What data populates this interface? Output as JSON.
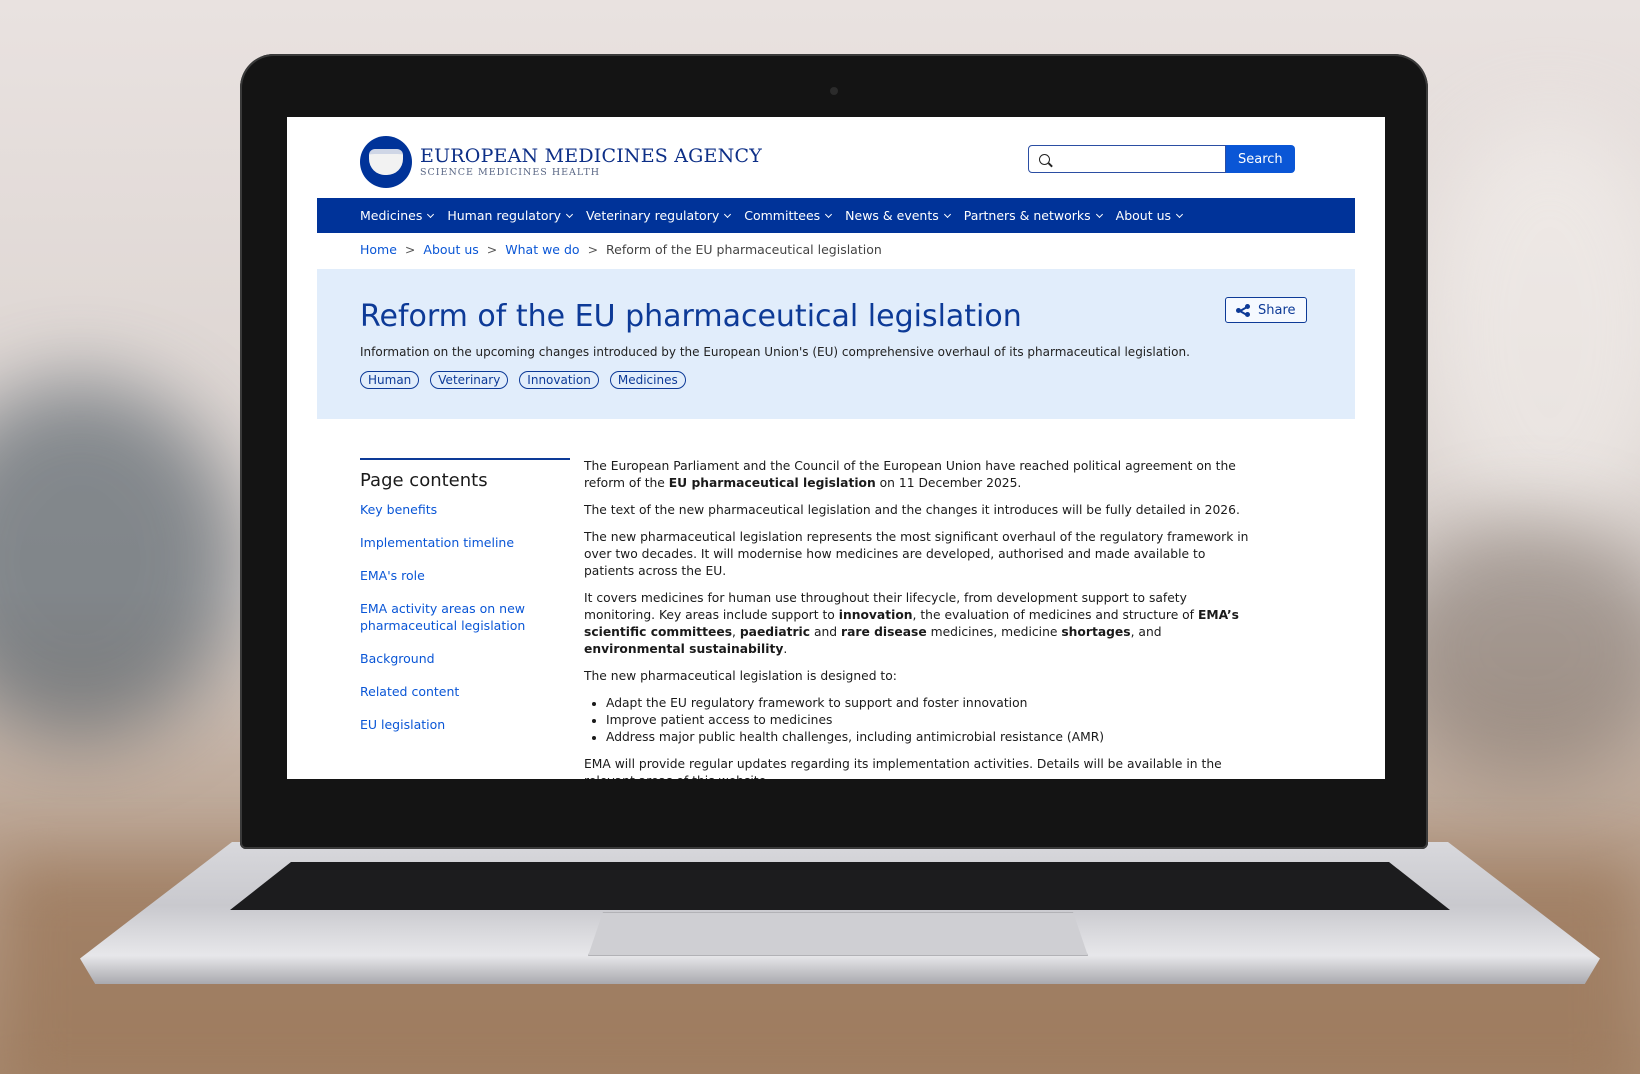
{
  "site": {
    "logo_main": "EUROPEAN MEDICINES AGENCY",
    "logo_sub": "SCIENCE   MEDICINES   HEALTH"
  },
  "search": {
    "placeholder": "",
    "button_label": "Search"
  },
  "nav": {
    "items": [
      "Medicines",
      "Human regulatory",
      "Veterinary regulatory",
      "Committees",
      "News & events",
      "Partners & networks",
      "About us"
    ]
  },
  "breadcrumb": {
    "items": [
      "Home",
      "About us",
      "What we do"
    ],
    "separator": ">",
    "current": "Reform of the EU pharmaceutical legislation"
  },
  "hero": {
    "title": "Reform of the EU pharmaceutical legislation",
    "description": "Information on the upcoming changes introduced by the European Union's (EU) comprehensive overhaul of its pharmaceutical legislation.",
    "share_label": "Share",
    "tags": [
      "Human",
      "Veterinary",
      "Innovation",
      "Medicines"
    ]
  },
  "toc": {
    "title": "Page contents",
    "items": [
      "Key benefits",
      "Implementation timeline",
      "EMA's role",
      "EMA activity areas on new pharmaceutical legislation",
      "Background",
      "Related content",
      "EU legislation"
    ]
  },
  "content": {
    "p1_a": "The European Parliament and the Council of the European Union have reached political agreement on the reform of the ",
    "p1_b": "EU pharmaceutical legislation",
    "p1_c": " on 11 December 2025.",
    "p2": "The text of the new pharmaceutical legislation and the changes it introduces will be fully detailed in 2026.",
    "p3": "The new pharmaceutical legislation represents the most significant overhaul of the regulatory framework in over two decades. It will modernise how medicines are developed, authorised and made available to patients across the EU.",
    "p4_a": "It covers medicines for human use throughout their lifecycle, from development support to safety monitoring. Key areas include support to ",
    "p4_b": "innovation",
    "p4_c": ", the evaluation of medicines and structure of ",
    "p4_d": "EMA’s scientific committees",
    "p4_e": ", ",
    "p4_f": "paediatric",
    "p4_g": " and ",
    "p4_h": "rare disease",
    "p4_i": " medicines, medicine ",
    "p4_j": "shortages",
    "p4_k": ", and ",
    "p4_l": "environmental sustainability",
    "p4_m": ".",
    "p5": "The new pharmaceutical legislation is designed to:",
    "bullets": [
      "Adapt the EU regulatory framework to support and foster innovation",
      "Improve patient access to medicines",
      "Address major public health challenges, including antimicrobial resistance (AMR)"
    ],
    "p6": "EMA will provide regular updates regarding its implementation activities. Details will be available in the relevant areas of this website."
  },
  "colors": {
    "brand_blue": "#003399",
    "link_blue": "#0a56d6",
    "hero_bg": "#e1edfb"
  }
}
